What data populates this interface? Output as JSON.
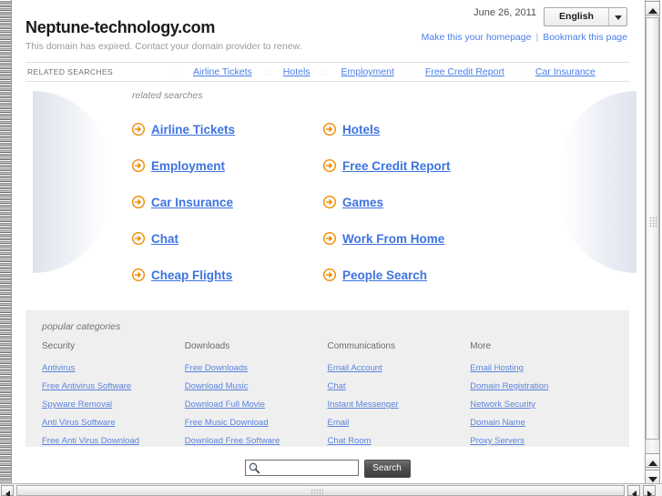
{
  "header": {
    "site_title": "Neptune-technology.com",
    "tagline": "This domain has expired. Contact your domain provider to renew.",
    "date": "June 26, 2011",
    "language_selected": "English",
    "make_homepage_label": "Make this your homepage",
    "bookmark_label": "Bookmark this page",
    "divider": "|"
  },
  "nav": {
    "label": "RELATED SEARCHES",
    "separator": "::",
    "links": [
      "Airline Tickets",
      "Hotels",
      "Employment",
      "Free Credit Report",
      "Car Insurance"
    ]
  },
  "related": {
    "heading": "related searches",
    "items": [
      "Airline Tickets",
      "Hotels",
      "Employment",
      "Free Credit Report",
      "Car Insurance",
      "Games",
      "Chat",
      "Work From Home",
      "Cheap Flights",
      "People Search"
    ]
  },
  "categories": {
    "heading": "popular categories",
    "columns": [
      {
        "title": "Security",
        "links": [
          "Antivirus",
          "Free Antivirus Software",
          "Spyware Removal",
          "Anti Virus Software",
          "Free Anti Virus Download"
        ]
      },
      {
        "title": "Downloads",
        "links": [
          "Free Downloads",
          "Download Music",
          "Download Full Movie",
          "Free Music Download",
          "Download Free Software"
        ]
      },
      {
        "title": "Communications",
        "links": [
          "Email Account",
          "Chat",
          "Instant Messenger",
          "Email",
          "Chat Room"
        ]
      },
      {
        "title": "More",
        "links": [
          "Email Hosting",
          "Domain Registration",
          "Network Security",
          "Domain Name",
          "Proxy Servers"
        ]
      }
    ]
  },
  "search": {
    "value": "",
    "placeholder": "",
    "button_label": "Search"
  },
  "colors": {
    "link_blue": "#3d74e0",
    "nav_link_blue": "#4a7ee8",
    "category_link_blue": "#5b84dd",
    "arrow_orange": "#f08a00",
    "panel_gray": "#efefef",
    "muted_text": "#9a9a9a"
  }
}
